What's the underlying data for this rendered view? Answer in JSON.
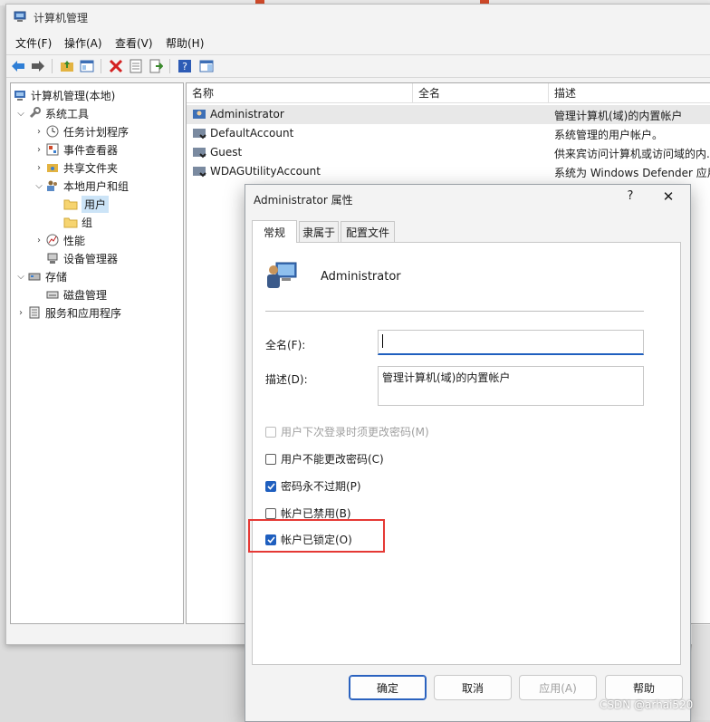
{
  "window": {
    "title": "计算机管理"
  },
  "menubar": {
    "file": "文件(F)",
    "action": "操作(A)",
    "view": "查看(V)",
    "help": "帮助(H)"
  },
  "tree": {
    "root": "计算机管理(本地)",
    "system_tools": "系统工具",
    "task_scheduler": "任务计划程序",
    "event_viewer": "事件查看器",
    "shared_folders": "共享文件夹",
    "local_users_groups": "本地用户和组",
    "users": "用户",
    "groups": "组",
    "performance": "性能",
    "device_manager": "设备管理器",
    "storage": "存储",
    "disk_management": "磁盘管理",
    "services_apps": "服务和应用程序"
  },
  "list": {
    "columns": [
      "名称",
      "全名",
      "描述"
    ],
    "rows": [
      {
        "name": "Administrator",
        "full_name": "",
        "description": "管理计算机(域)的内置帐户"
      },
      {
        "name": "DefaultAccount",
        "full_name": "",
        "description": "系统管理的用户帐户。"
      },
      {
        "name": "Guest",
        "full_name": "",
        "description": "供来宾访问计算机或访问域的内..."
      },
      {
        "name": "WDAGUtilityAccount",
        "full_name": "",
        "description": "系统为 Windows Defender 应用..."
      }
    ]
  },
  "dialog": {
    "title": "Administrator 属性",
    "help": "?",
    "close": "✕",
    "tabs": [
      "常规",
      "隶属于",
      "配置文件"
    ],
    "username": "Administrator",
    "fullname_label": "全名(F):",
    "fullname_value": "",
    "description_label": "描述(D):",
    "description_value": "管理计算机(域)的内置帐户",
    "options": [
      {
        "label": "用户下次登录时须更改密码(M)",
        "checked": false,
        "disabled": true
      },
      {
        "label": "用户不能更改密码(C)",
        "checked": false,
        "disabled": false
      },
      {
        "label": "密码永不过期(P)",
        "checked": true,
        "disabled": false
      },
      {
        "label": "帐户已禁用(B)",
        "checked": false,
        "disabled": false
      },
      {
        "label": "帐户已锁定(O)",
        "checked": true,
        "disabled": false
      }
    ],
    "buttons": {
      "ok": "确定",
      "cancel": "取消",
      "apply": "应用(A)",
      "help": "帮助"
    }
  },
  "watermark": "CSDN @arhai520",
  "colors": {
    "accent": "#1f5fbf",
    "highlight": "#e53935",
    "selection": "#cce4f7"
  }
}
